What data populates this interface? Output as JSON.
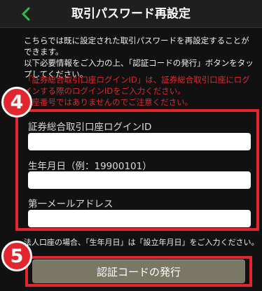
{
  "header": {
    "title": "取引パスワード再設定",
    "back_icon": "chevron-left-icon"
  },
  "intro": {
    "line1": "こちらでは既に設定された取引パスワードを再設定することができます。",
    "line2": "以下必要情報をご入力の上、「認証コードの発行」ボタンをタップしてください。"
  },
  "warning": {
    "line1": "「証券総合取引口座ログインID」は、証券総合取引口座にログインする際のログインIDをご入力ください。",
    "line2": "口座番号ではありませんのでご注意ください。"
  },
  "form": {
    "fields": [
      {
        "label": "証券総合取引口座ログインID",
        "value": "",
        "placeholder": ""
      },
      {
        "label": "生年月日（例：19900101）",
        "value": "",
        "placeholder": ""
      },
      {
        "label": "第一メールアドレス",
        "value": "",
        "placeholder": ""
      }
    ]
  },
  "note": "法人口座の場合、「生年月日」は「設立年月日」をご入力ください。",
  "submit_label": "認証コードの発行",
  "steps": {
    "form_step": "4",
    "button_step": "5"
  },
  "colors": {
    "accent_red": "#e3262d",
    "back_green": "#2fbf4f",
    "button_bg": "#7b7765",
    "background": "#111111"
  }
}
